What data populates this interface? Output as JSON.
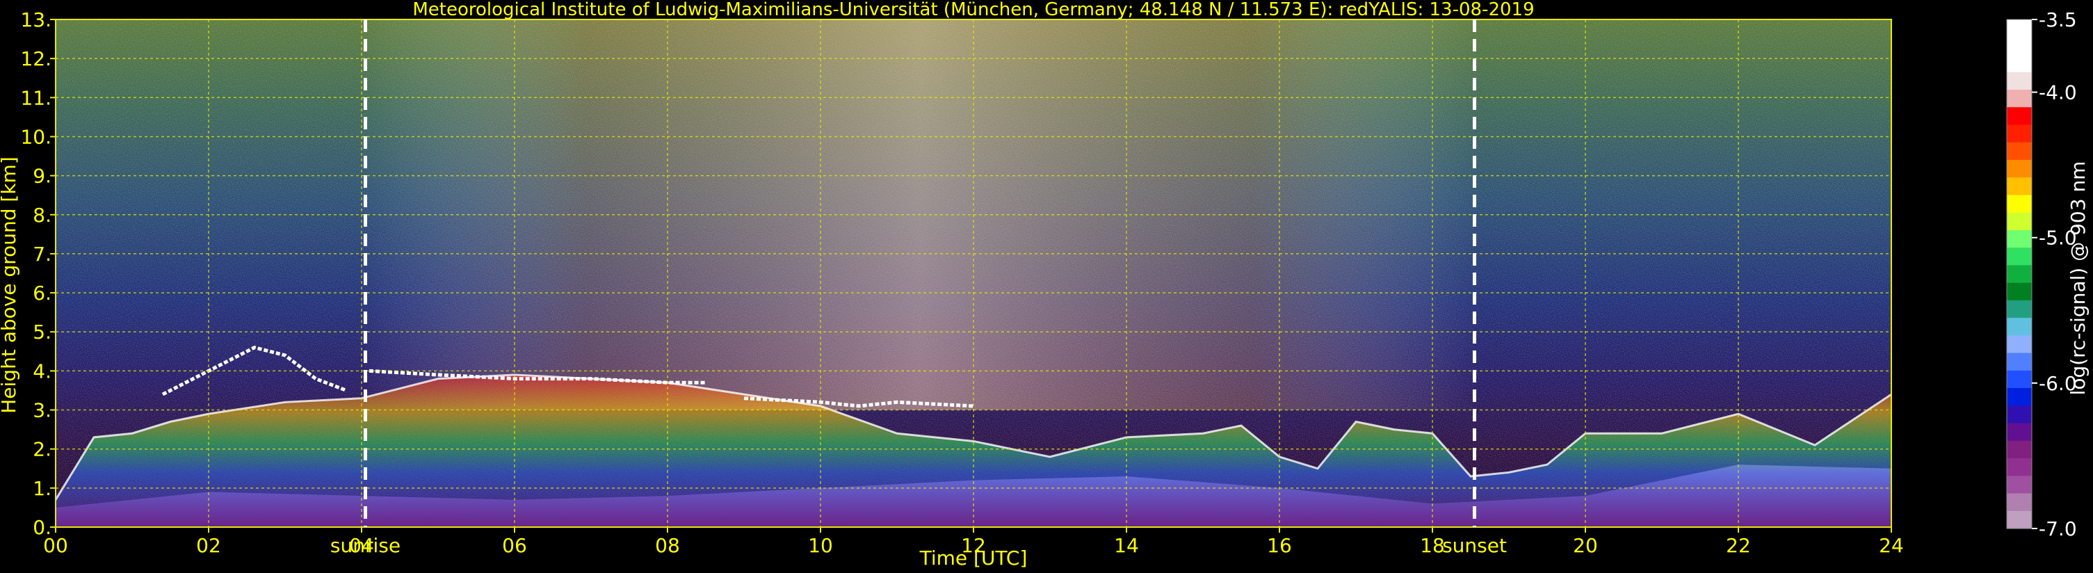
{
  "chart_data": {
    "type": "heatmap",
    "title": "Meteorological Institute of Ludwig-Maximilians-Universität (München, Germany; 48.148 N / 11.573 E):    redYALIS: 13-08-2019",
    "xlabel": "Time [UTC]",
    "ylabel": "Height above ground [km]",
    "xlim": [
      0,
      24
    ],
    "ylim": [
      0,
      13
    ],
    "x_ticks": [
      0,
      2,
      4,
      6,
      8,
      10,
      12,
      14,
      16,
      18,
      20,
      22,
      24
    ],
    "x_tick_labels": [
      "00",
      "02",
      "04",
      "06",
      "08",
      "10",
      "12",
      "14",
      "16",
      "18",
      "20",
      "22",
      "24"
    ],
    "y_ticks": [
      0,
      1,
      2,
      3,
      4,
      5,
      6,
      7,
      8,
      9,
      10,
      11,
      12,
      13
    ],
    "y_tick_labels": [
      "0.",
      "1.",
      "2.",
      "3.",
      "4.",
      "5.",
      "6.",
      "7.",
      "8.",
      "9.",
      "10.",
      "11.",
      "12.",
      "13."
    ],
    "grid": true,
    "events": [
      {
        "label": "sunrise",
        "x": 4.05
      },
      {
        "label": "sunset",
        "x": 18.55
      }
    ],
    "colorbar": {
      "label": "log(rc-signal) @ 903 nm",
      "range": [
        -7.0,
        -3.5
      ],
      "ticks": [
        -3.5,
        -4.0,
        -5.0,
        -6.0,
        -7.0
      ],
      "tick_labels": [
        "-3.5",
        "-4.0",
        "-5.0",
        "-6.0",
        "-7.0"
      ],
      "colors": [
        "#ffffff",
        "#ffffff",
        "#ffffff",
        "#f0e0e0",
        "#f0b0b0",
        "#ff0000",
        "#ff2000",
        "#ff5000",
        "#ff8c00",
        "#ffc000",
        "#ffff00",
        "#d0ff30",
        "#70ff70",
        "#30e060",
        "#10b040",
        "#008020",
        "#20a080",
        "#60c0e0",
        "#90b0ff",
        "#5080ff",
        "#2050ff",
        "#0020e0",
        "#3010b0",
        "#601090",
        "#802080",
        "#903090",
        "#a050a0",
        "#b080b0",
        "#c0a0c0"
      ]
    },
    "boundary_layer_top": {
      "x": [
        0.0,
        0.5,
        1.0,
        1.5,
        2.0,
        3.0,
        4.0,
        5.0,
        6.0,
        7.0,
        8.0,
        9.0,
        10.0,
        11.0,
        12.0,
        13.0,
        14.0,
        15.0,
        15.5,
        16.0,
        16.5,
        17.0,
        17.5,
        18.0,
        18.5,
        19.0,
        19.5,
        20.0,
        21.0,
        22.0,
        22.5,
        23.0,
        24.0
      ],
      "y": [
        0.7,
        2.3,
        2.4,
        2.7,
        2.9,
        3.2,
        3.3,
        3.8,
        3.9,
        3.8,
        3.7,
        3.4,
        3.1,
        2.4,
        2.2,
        1.8,
        2.3,
        2.4,
        2.6,
        1.8,
        1.5,
        2.7,
        2.5,
        2.4,
        1.3,
        1.4,
        1.6,
        2.4,
        2.4,
        2.9,
        2.5,
        2.1,
        3.4
      ]
    },
    "cloud_layers": [
      {
        "x": [
          1.4,
          1.8,
          2.2,
          2.6,
          3.0,
          3.4,
          3.8
        ],
        "y": [
          3.4,
          3.8,
          4.2,
          4.6,
          4.4,
          3.8,
          3.5
        ]
      },
      {
        "x": [
          4.1,
          5.0,
          6.0,
          7.0,
          8.0,
          8.5
        ],
        "y": [
          4.0,
          3.9,
          3.8,
          3.8,
          3.7,
          3.7
        ]
      },
      {
        "x": [
          9.0,
          10.0,
          10.5,
          11.0,
          12.0
        ],
        "y": [
          3.3,
          3.2,
          3.1,
          3.2,
          3.1
        ]
      }
    ],
    "aerosol_layer_top": {
      "x": [
        0.0,
        2.0,
        4.0,
        6.0,
        8.0,
        10.0,
        12.0,
        14.0,
        16.0,
        18.0,
        20.0,
        22.0,
        24.0
      ],
      "y": [
        0.5,
        0.9,
        0.8,
        0.7,
        0.8,
        1.0,
        1.2,
        1.3,
        1.0,
        0.6,
        0.8,
        1.6,
        1.5
      ]
    }
  }
}
